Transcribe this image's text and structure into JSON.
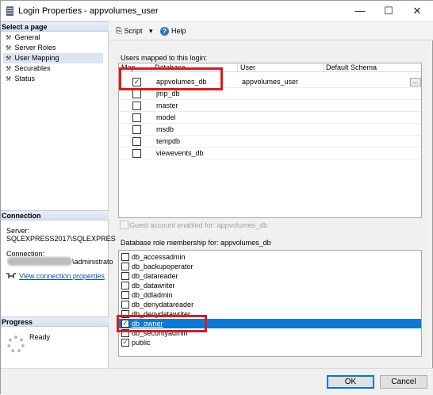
{
  "window": {
    "title": "Login Properties - appvolumes_user",
    "controls": {
      "minimize": "—",
      "maximize": "☐",
      "close": "✕"
    }
  },
  "sidebar": {
    "select_page_header": "Select a page",
    "pages": [
      "General",
      "Server Roles",
      "User Mapping",
      "Securables",
      "Status"
    ],
    "selected_page": "User Mapping",
    "connection_header": "Connection",
    "server_label": "Server:",
    "server_value": "SQLEXPRESS2017\\SQLEXPRES",
    "connection_label": "Connection:",
    "connection_value": "\\administrato",
    "view_connection_link": "View connection properties",
    "progress_header": "Progress",
    "progress_status": "Ready"
  },
  "toolbar": {
    "script_label": "Script",
    "script_dropdown": "▾",
    "help_label": "Help"
  },
  "mapping": {
    "group_label": "Users mapped to this login:",
    "columns": [
      "Map",
      "Database",
      "User",
      "Default Schema"
    ],
    "rows": [
      {
        "map": true,
        "database": "appvolumes_db",
        "user": "appvolumes_user",
        "schema": "",
        "ellipsis": "..."
      },
      {
        "map": false,
        "database": "jmp_db",
        "user": "",
        "schema": ""
      },
      {
        "map": false,
        "database": "master",
        "user": "",
        "schema": ""
      },
      {
        "map": false,
        "database": "model",
        "user": "",
        "schema": ""
      },
      {
        "map": false,
        "database": "msdb",
        "user": "",
        "schema": ""
      },
      {
        "map": false,
        "database": "tempdb",
        "user": "",
        "schema": ""
      },
      {
        "map": false,
        "database": "viewevents_db",
        "user": "",
        "schema": ""
      }
    ],
    "guest_label": "Guest account enabled for: appvolumes_db"
  },
  "roles": {
    "group_label": "Database role membership for: appvolumes_db",
    "items": [
      {
        "name": "db_accessadmin",
        "checked": false
      },
      {
        "name": "db_backupoperator",
        "checked": false
      },
      {
        "name": "db_datareader",
        "checked": false
      },
      {
        "name": "db_datawriter",
        "checked": false
      },
      {
        "name": "db_ddladmin",
        "checked": false
      },
      {
        "name": "db_denydatareader",
        "checked": false
      },
      {
        "name": "db_denydatawriter",
        "checked": false
      },
      {
        "name": "db_owner",
        "checked": true
      },
      {
        "name": "db_securityadmin",
        "checked": false
      },
      {
        "name": "public",
        "checked": true
      }
    ],
    "selected": "db_owner"
  },
  "footer": {
    "ok_label": "OK",
    "cancel_label": "Cancel"
  },
  "colors": {
    "highlight_box": "#e0191b",
    "selection": "#0a78d7",
    "link": "#0b4fb5"
  },
  "icons": {
    "app": "sql-server-icon",
    "page": "wrench-icon",
    "script": "script-icon",
    "help": "help-icon",
    "view_connection": "connection-icon",
    "progress": "spinner-icon"
  }
}
